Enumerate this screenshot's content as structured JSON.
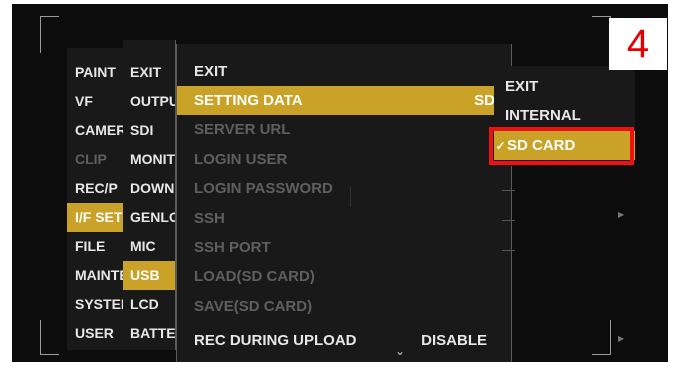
{
  "step_badge": "4",
  "menu_col1": [
    "PAINT",
    "VF",
    "CAMERA",
    "CLIP",
    "REC/P",
    "I/F SETUP",
    "FILE",
    "MAINTENANCE",
    "SYSTEM",
    "USER"
  ],
  "menu_col2": [
    "EXIT",
    "OUTPUT",
    "SDI",
    "MONITOR",
    "DOWNCONVERT",
    "GENLOCK",
    "MIC",
    "USB",
    "LCD",
    "BATTERY"
  ],
  "settings": {
    "exit": "EXIT",
    "setting_data": "SETTING DATA",
    "setting_data_value": "SD",
    "server_url": "SERVER URL",
    "login_user": "LOGIN USER",
    "login_password": "LOGIN PASSWORD",
    "ssh": "SSH",
    "ssh_port": "SSH PORT",
    "load": "LOAD(SD CARD)",
    "save": "SAVE(SD CARD)",
    "rec_upload": "REC DURING UPLOAD",
    "rec_upload_value": "DISABLE"
  },
  "submenu": {
    "exit": "EXIT",
    "internal": "INTERNAL",
    "sd_card": "SD CARD",
    "check": "✓"
  }
}
